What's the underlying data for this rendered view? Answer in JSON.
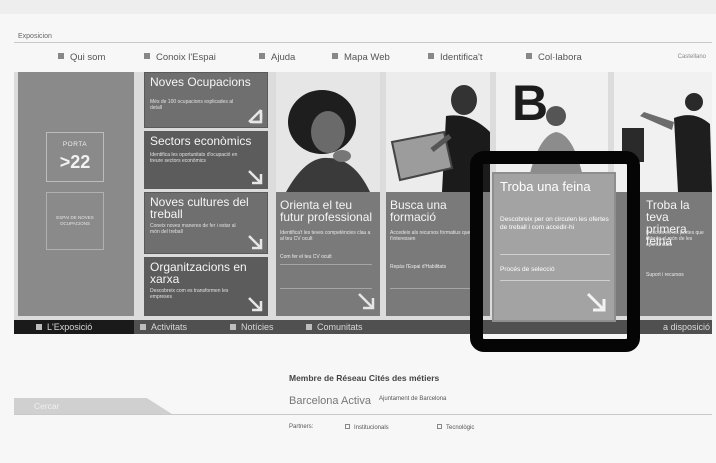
{
  "site": {
    "title": "Exposicion"
  },
  "topnav": {
    "items": [
      {
        "label": "Qui som"
      },
      {
        "label": "Conoix l'Espai"
      },
      {
        "label": "Ajuda"
      },
      {
        "label": "Mapa Web"
      },
      {
        "label": "Identifica't"
      },
      {
        "label": "Col·labora"
      }
    ],
    "language": "Castellano"
  },
  "porta": {
    "label": "PORTA",
    "number": ">22",
    "small_text": "ESPAI DE NOVES OCUPACIONS"
  },
  "stack": [
    {
      "title": "Noves Ocupacions",
      "desc": "Més de 100 ocupacions explicades al detall"
    },
    {
      "title": "Sectors econòmics",
      "desc": "Identifica les oportunitats d'ocupació en treure sectors econòmics"
    },
    {
      "title": "Noves cultures del treball",
      "desc": "Coneix noves maneres de fer i estar al món del treball"
    },
    {
      "title": "Organitzacions en xarxa",
      "desc": "Descobreix com es transformen les empreses"
    }
  ],
  "panels": [
    {
      "title": "Orienta el teu futur professional",
      "desc": "Identifica't les teves competències clau a al teu CV ocult",
      "link": "Com fer el teu CV ocult"
    },
    {
      "title": "Busca una formació",
      "desc": "Accedeix als recursos formatius que més t'interessen",
      "link": "Repàs l'Espai d'Habilitats"
    },
    {
      "title": "Troba la teva primera feina",
      "desc": "Descobreix les portes que t'obren el món de les oportunitats",
      "link": "Suport i recursos"
    }
  ],
  "featured": {
    "title": "Troba una feina",
    "desc": "Descobreix per on circulen les ofertes de treball i com accedir-hi",
    "link": "Procés de selecció"
  },
  "secnav": {
    "items": [
      {
        "label": "L'Exposició"
      },
      {
        "label": "Activitats"
      },
      {
        "label": "Notícies"
      },
      {
        "label": "Comunitats"
      }
    ],
    "tail": "a disposició"
  },
  "search": {
    "label": "Cercar"
  },
  "footer": {
    "member": "Membre de Réseau Cités des métiers",
    "logo_bcn": "Barcelona Activa",
    "logo_ajunt": "Ajuntament de Barcelona",
    "partners_label": "Partners:",
    "partners": [
      {
        "label": "Institucionals"
      },
      {
        "label": "Tecnològic"
      }
    ]
  },
  "colors": {
    "band": "#dcdcdc",
    "tile": "#6f6f6f",
    "featured": "#a3a3a3",
    "frame": "#050505"
  }
}
